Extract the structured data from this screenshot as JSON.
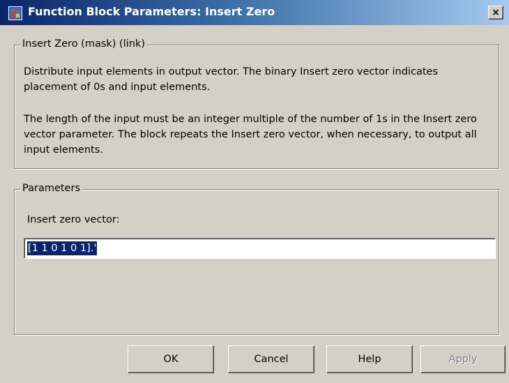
{
  "window": {
    "title": "Function Block Parameters: Insert Zero",
    "close_label": "×"
  },
  "block_group": {
    "legend": "Insert Zero (mask) (link)",
    "description_1": "Distribute input elements in output vector. The binary Insert zero vector indicates placement of 0s and input elements.",
    "description_2": "The length of the input must be an integer multiple of the number of 1s in the Insert zero vector parameter. The block repeats the Insert zero vector, when necessary, to output all input elements."
  },
  "parameters_group": {
    "legend": "Parameters",
    "insert_zero_vector_label": "Insert zero vector:",
    "insert_zero_vector_value": "[1 1 0 1 0 1].'"
  },
  "buttons": {
    "ok": "OK",
    "cancel": "Cancel",
    "help": "Help",
    "apply": "Apply"
  },
  "icons": {
    "app": "simulink-block-icon",
    "close": "close-icon"
  },
  "colors": {
    "titlebar_start": "#0a246a",
    "titlebar_end": "#a6caf0",
    "dialog_bg": "#d4d0c8",
    "selection_bg": "#0a246a"
  }
}
